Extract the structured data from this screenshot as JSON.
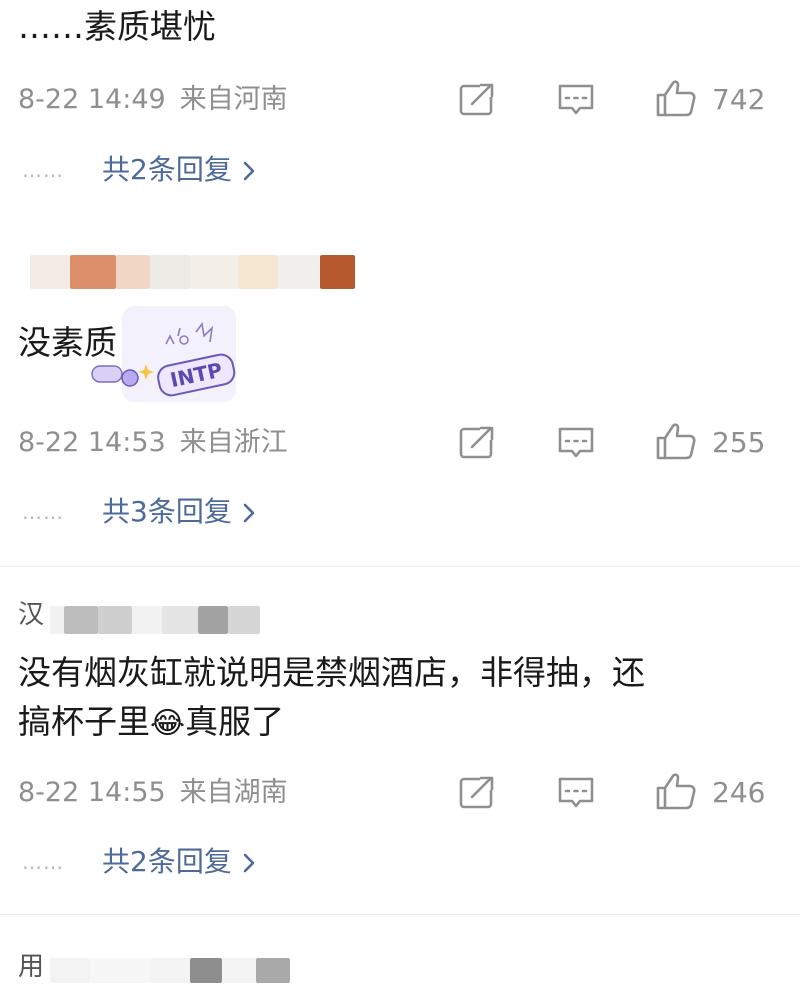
{
  "comments": [
    {
      "text": "……素质堪忧",
      "date": "8-22 14:49",
      "location": "来自河南",
      "likes": "742",
      "replies_dots": "……",
      "replies_label": "共2条回复"
    },
    {
      "username": "",
      "text": "没素质",
      "sticker_label": "INTP",
      "date": "8-22 14:53",
      "location": "来自浙江",
      "likes": "255",
      "replies_dots": "……",
      "replies_label": "共3条回复"
    },
    {
      "username_partial": "汉",
      "text_line1": "没有烟灰缸就说明是禁烟酒店，非得抽，还",
      "text_line2_before": "搞杯子里",
      "emoji": "😂",
      "text_line2_after": "真服了",
      "date": "8-22 14:55",
      "location": "来自湖南",
      "likes": "246",
      "replies_dots": "……",
      "replies_label": "共2条回复"
    },
    {
      "username_partial": "用"
    }
  ],
  "icons": {
    "forward": "forward-icon",
    "reply": "comment-icon",
    "like": "thumbs-up-icon",
    "chevron": "chevron-right-icon"
  },
  "colors": {
    "meta_gray": "#8f8f8f",
    "link_blue": "#4d6a9a",
    "text_dark": "#1a1a1a",
    "divider": "#ececec"
  }
}
